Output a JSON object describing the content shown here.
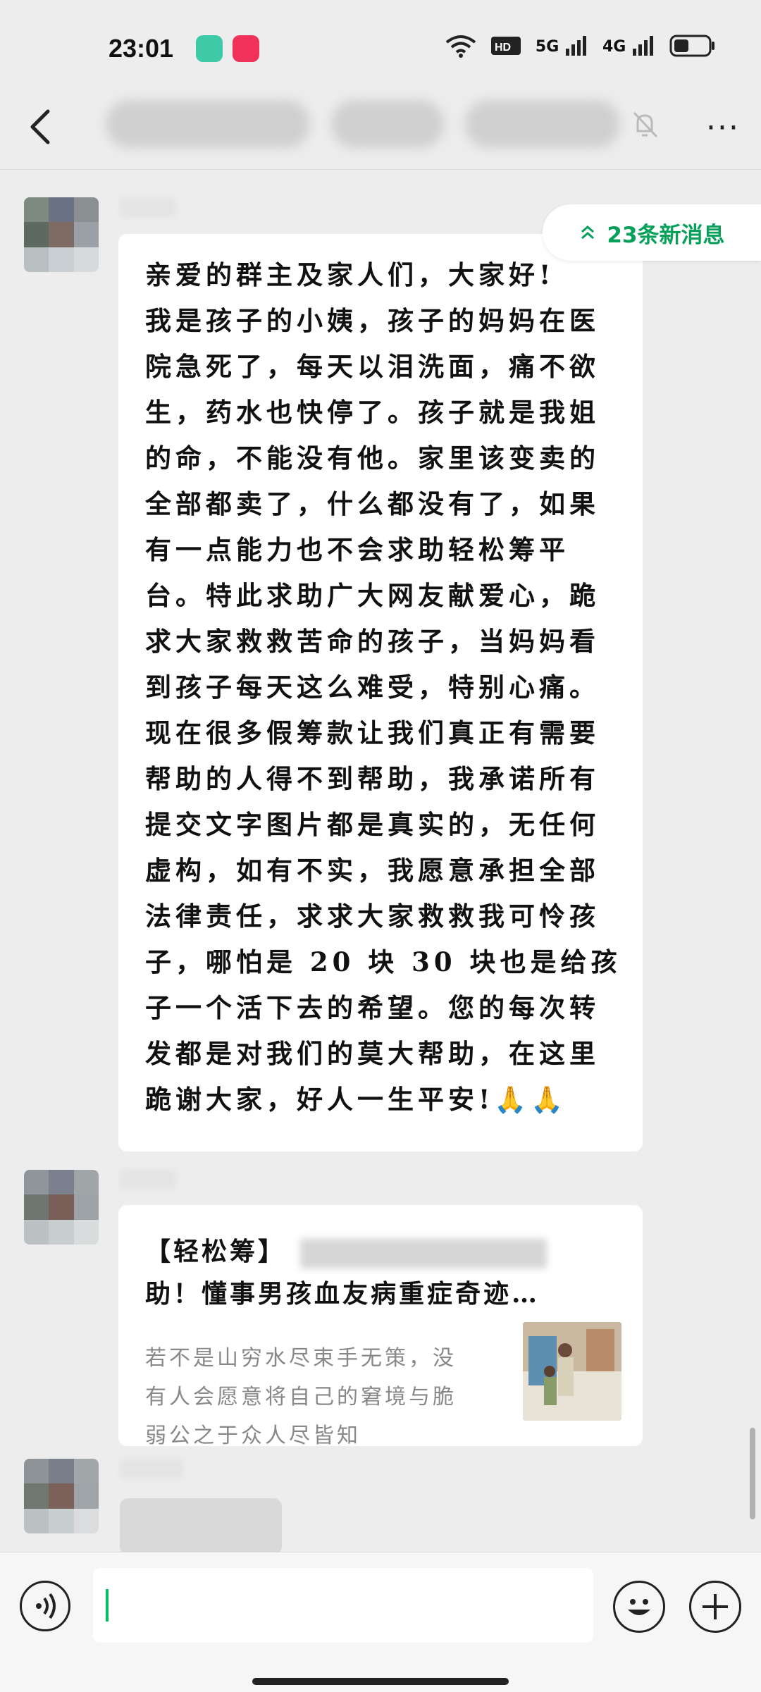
{
  "status_bar": {
    "time": "23:01",
    "network": "5G",
    "network2": "4G"
  },
  "title_bar": {
    "back_icon": "back-arrow-icon",
    "mute_icon": "bell-off-icon",
    "more_icon": "more-icon",
    "more_label": "···"
  },
  "chat": {
    "new_messages_label": "23条新消息",
    "message_text": "亲爱的群主及家人们，大家好!\n我是孩子的小姨，孩子的妈妈在医院急死了，每天以泪洗面，痛不欲生，药水也快停了。孩子就是我姐的命，不能没有他。家里该变卖的全部都卖了，什么都没有了，如果有一点能力也不会求助轻松筹平台。特此求助广大网友献爱心，跪求大家救救苦命的孩子，当妈妈看到孩子每天这么难受，特别心痛。现在很多假筹款让我们真正有需要帮助的人得不到帮助，我承诺所有提交文字图片都是真实的，无任何虚构，如有不实，我愿意承担全部法律责任，求求大家救救我可怜孩子，哪怕是 20 块 30 块也是给孩子一个活下去的希望。您的每次转发都是对我们的莫大帮助，在这里跪谢大家，好人一生平安!🙏🙏",
    "card": {
      "title_prefix": "【轻松筹】",
      "title_line2": "助！懂事男孩血友病重症奇迹…",
      "description": "若不是山穷水尽束手无策，没有人会愿意将自己的窘境与脆弱公之于众人尽皆知"
    }
  },
  "input_bar": {
    "voice_icon": "voice-icon",
    "emoji_icon": "emoji-icon",
    "plus_icon": "plus-icon"
  },
  "colors": {
    "accent_green": "#07c160",
    "new_msg_green": "#07a05a",
    "background": "#ededed"
  }
}
